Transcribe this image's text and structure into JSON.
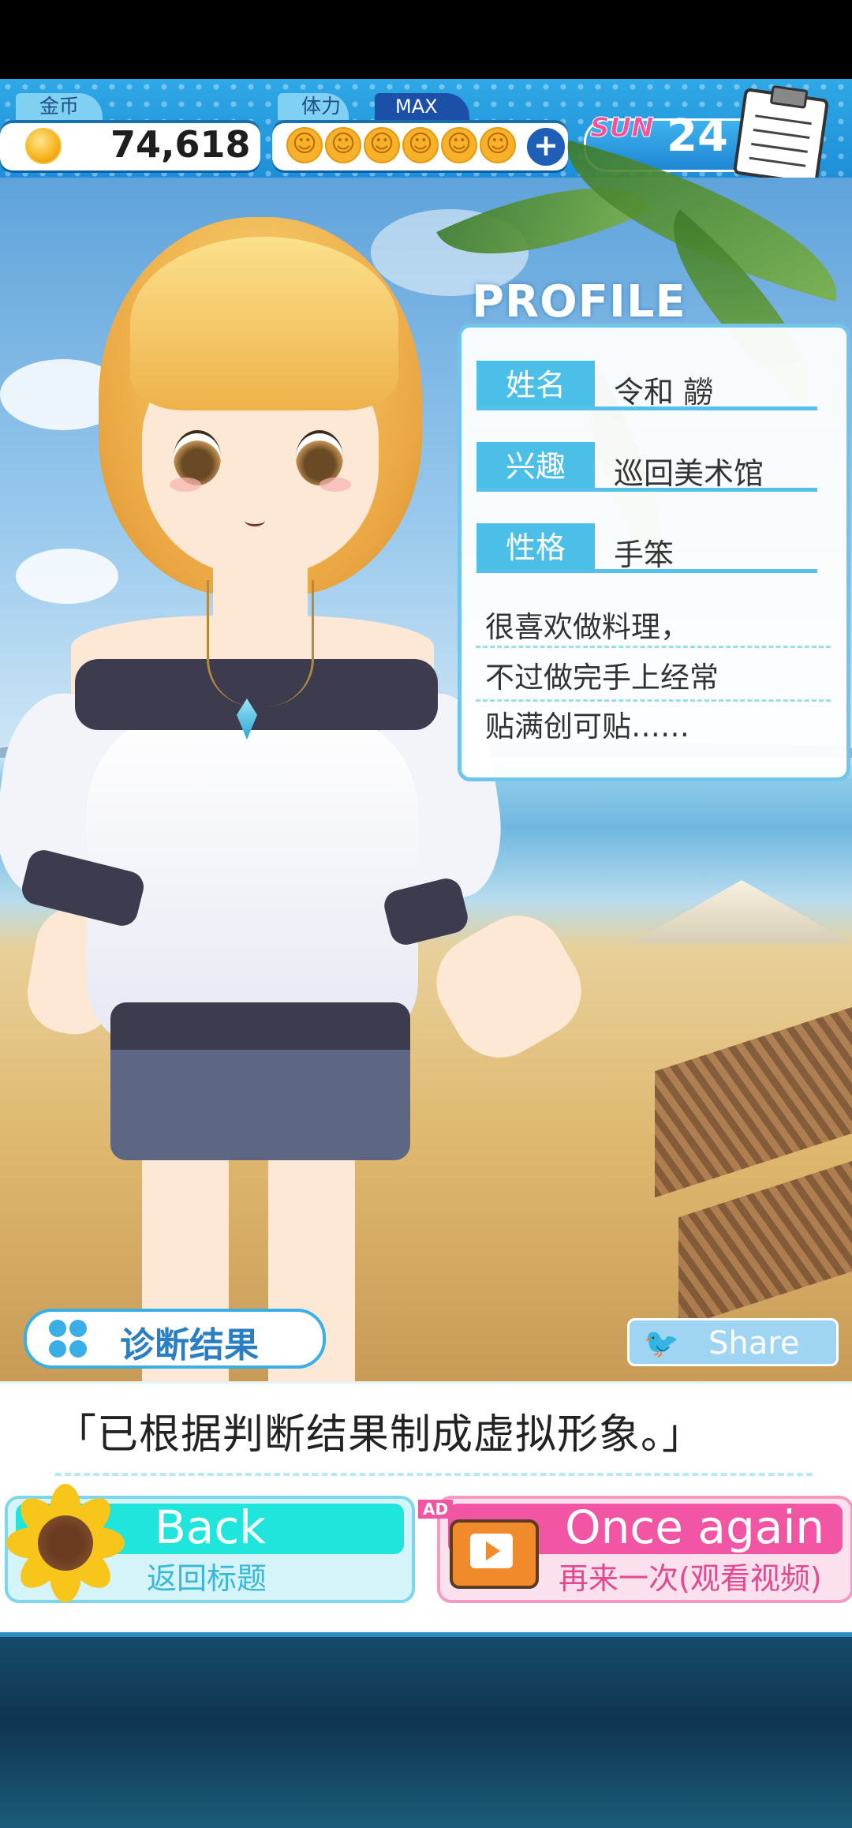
{
  "status_bar": {
    "gold_label": "金币",
    "gold_value": "74,618",
    "stamina_label": "体力",
    "stamina_max_label": "MAX",
    "stamina_icon": "smile-face-icon",
    "stamina_count": 6,
    "day_label": "SUN",
    "day_number": "24",
    "notepad_icon": "notepad-icon"
  },
  "profile": {
    "title": "PROFILE",
    "fields": [
      {
        "label": "姓名",
        "value": "令和 髝"
      },
      {
        "label": "兴趣",
        "value": "巡回美术馆"
      },
      {
        "label": "性格",
        "value": "手笨"
      }
    ],
    "description": [
      "很喜欢做料理，",
      "不过做完手上经常",
      "贴满创可贴……"
    ]
  },
  "result_badge": {
    "label": "诊断结果",
    "icon": "clover-icon"
  },
  "share": {
    "label": "Share",
    "icon": "twitter-bird-icon"
  },
  "dialog": {
    "text": "「已根据判断结果制成虚拟形象。」"
  },
  "buttons": {
    "back": {
      "label": "Back",
      "sublabel": "返回标题",
      "icon": "sunflower-icon"
    },
    "once_again": {
      "label": "Once again",
      "sublabel": "再来一次(观看视频)",
      "icon": "tv-video-icon",
      "badge": "AD"
    }
  },
  "colors": {
    "accent_blue": "#3aaee6",
    "back_button": "#1fe5dc",
    "once_button": "#f155a3"
  }
}
